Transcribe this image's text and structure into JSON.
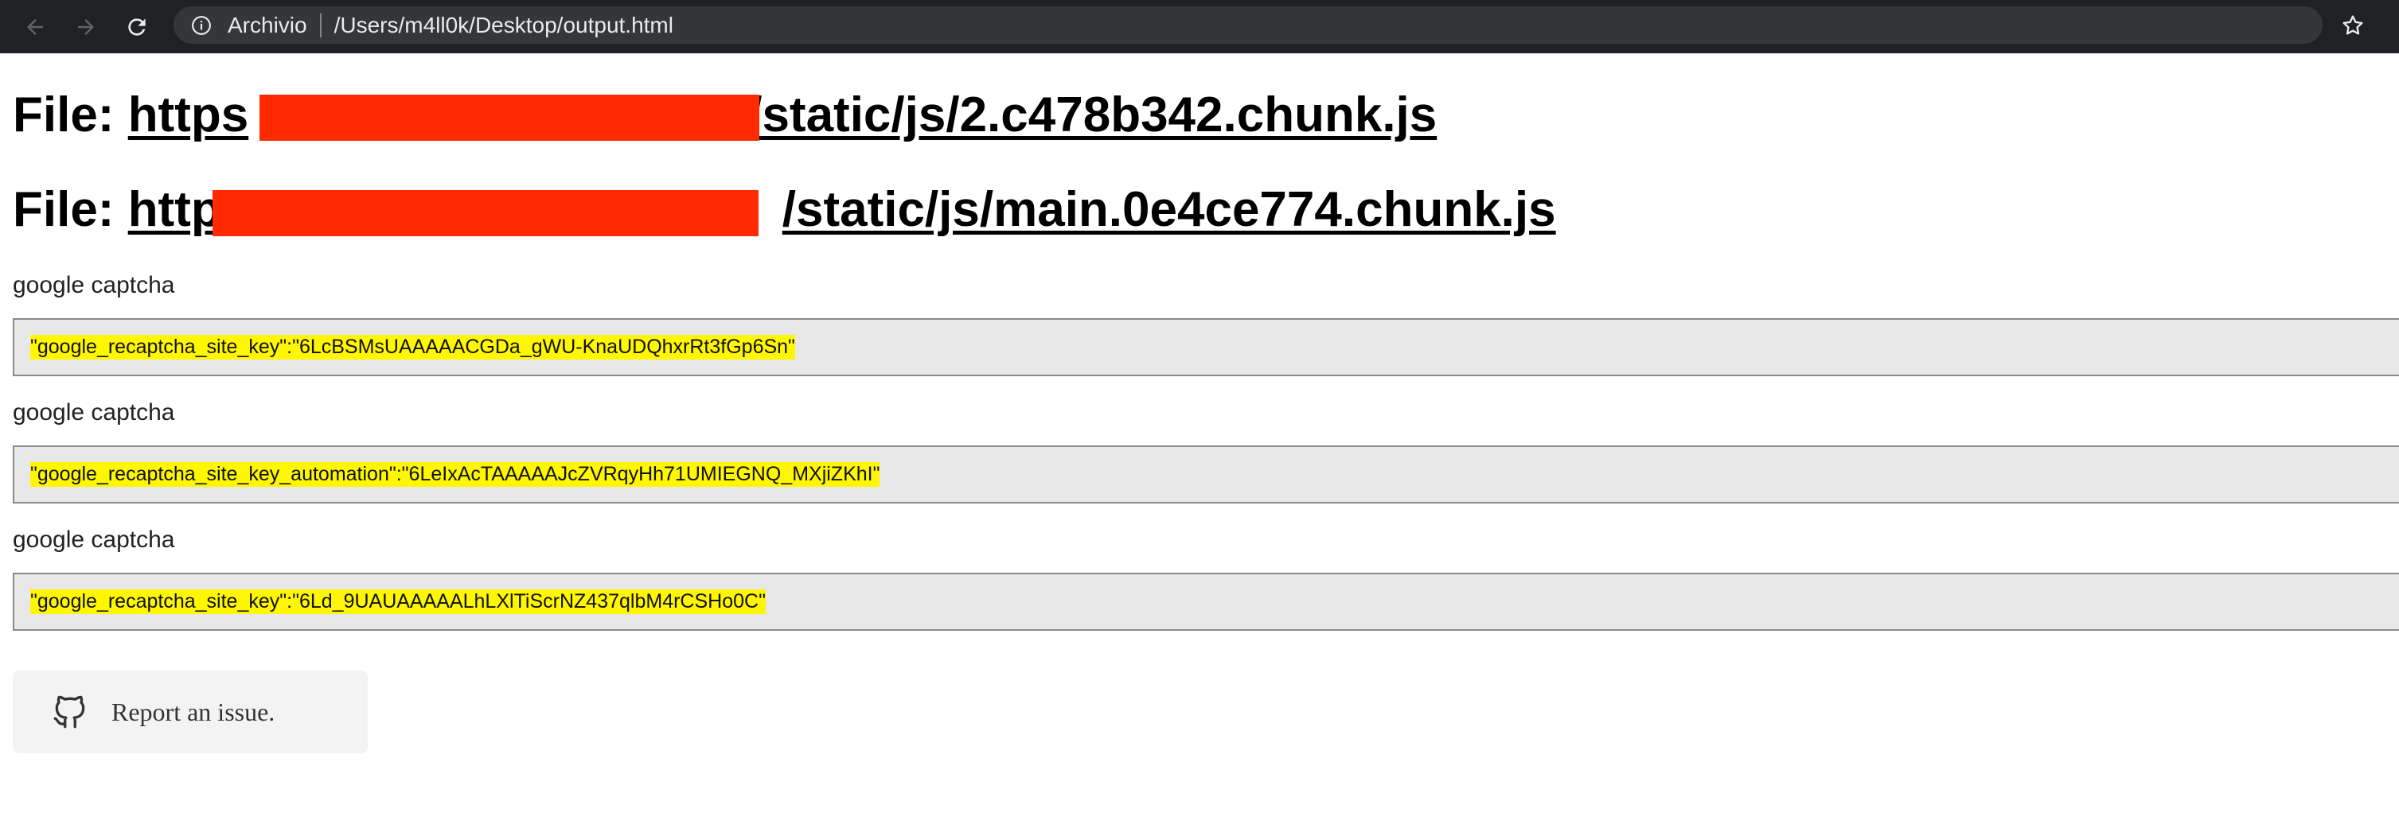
{
  "browser": {
    "site_info_label": "Archivio",
    "url": "/Users/m4ll0k/Desktop/output.html",
    "icons": {
      "back": "arrow-left-icon",
      "forward": "arrow-right-icon",
      "reload": "reload-icon",
      "info": "info-icon",
      "bookmark": "star-icon"
    }
  },
  "files": [
    {
      "prefix": "File: ",
      "url_visible_start": "https",
      "url_visible_end": "/static/js/2.c478b342.chunk.js"
    },
    {
      "prefix": "File: ",
      "url_visible_start": "http",
      "url_visible_end": "/static/js/main.0e4ce774.chunk.js"
    }
  ],
  "findings": [
    {
      "label": "google captcha",
      "match": "\"google_recaptcha_site_key\":\"6LcBSMsUAAAAACGDa_gWU-KnaUDQhxrRt3fGp6Sn\""
    },
    {
      "label": "google captcha",
      "match": "\"google_recaptcha_site_key_automation\":\"6LeIxAcTAAAAAJcZVRqyHh71UMIEGNQ_MXjiZKhI\""
    },
    {
      "label": "google captcha",
      "match": "\"google_recaptcha_site_key\":\"6Ld_9UAUAAAAALhLXlTiScrNZ437qlbM4rCSHo0C\""
    }
  ],
  "report": {
    "label": "Report an issue.",
    "icon": "github-icon"
  },
  "colors": {
    "highlight": "#fff700",
    "redaction": "#ff2a00",
    "chrome_bg": "#202124",
    "omnibox_bg": "#35363a"
  }
}
